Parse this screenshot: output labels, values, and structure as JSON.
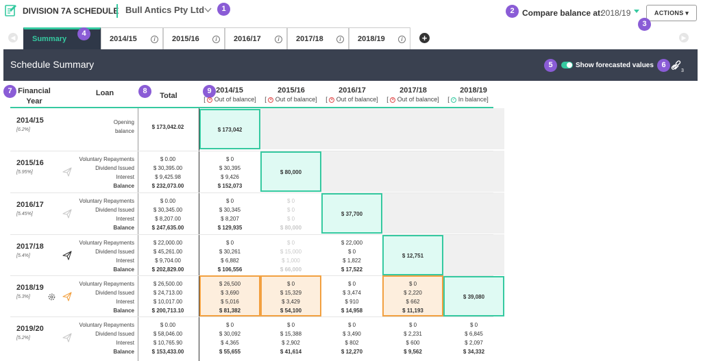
{
  "header": {
    "app_title": "DIVISION 7A SCHEDULE",
    "company": "Bull Antics Pty Ltd",
    "compare_label": "Compare balance at:",
    "compare_value": "2018/19",
    "actions_label": "ACTIONS ▾"
  },
  "badges": [
    "1",
    "2",
    "3",
    "4",
    "5",
    "6",
    "7",
    "8",
    "9"
  ],
  "tabs": [
    {
      "label": "Summary",
      "active": true
    },
    {
      "label": "2014/15"
    },
    {
      "label": "2015/16"
    },
    {
      "label": "2016/17"
    },
    {
      "label": "2017/18"
    },
    {
      "label": "2018/19"
    }
  ],
  "summary": {
    "title": "Schedule Summary",
    "toggle_label": "Show forecasted values",
    "link_count": "3"
  },
  "columns": {
    "financial_year": "Financial Year",
    "loan": "Loan",
    "total": "Total",
    "years": [
      {
        "label": "2014/15",
        "status": "Out of balance",
        "ok": false
      },
      {
        "label": "2015/16",
        "status": "Out of balance",
        "ok": false
      },
      {
        "label": "2016/17",
        "status": "Out of balance",
        "ok": false
      },
      {
        "label": "2017/18",
        "status": "Out of balance",
        "ok": false
      },
      {
        "label": "2018/19",
        "status": "In balance",
        "ok": true
      }
    ]
  },
  "row_labels": {
    "opening_1": "Opening",
    "opening_2": "balance",
    "voluntary": "Voluntary Repayments",
    "dividend": "Dividend Issued",
    "interest": "Interest",
    "balance": "Balance"
  },
  "rows": [
    {
      "fy": "2014/15",
      "rate": "[6.2%]",
      "opening_total": "$ 173,042.02",
      "diag": "$ 173,042"
    },
    {
      "fy": "2015/16",
      "rate": "[5.95%]",
      "totals": [
        "$ 0.00",
        "$ 30,395.00",
        "$ 9,425.98",
        "$ 232,073.00"
      ],
      "cols": [
        [
          "$ 0",
          "$ 30,395",
          "$ 9,426",
          "$ 152,073"
        ]
      ],
      "diag": "$ 80,000"
    },
    {
      "fy": "2016/17",
      "rate": "[5.45%]",
      "totals": [
        "$ 0.00",
        "$ 30,345.00",
        "$ 8,207.00",
        "$ 247,635.00"
      ],
      "cols": [
        [
          "$ 0",
          "$ 30,345",
          "$ 8,207",
          "$ 129,935"
        ],
        [
          "$ 0",
          "$ 0",
          "$ 0",
          "$ 80,000"
        ]
      ],
      "diag": "$ 37,700"
    },
    {
      "fy": "2017/18",
      "rate": "[5.4%]",
      "totals": [
        "$ 22,000.00",
        "$ 45,261.00",
        "$ 9,704.00",
        "$ 202,829.00"
      ],
      "cols": [
        [
          "$ 0",
          "$ 30,261",
          "$ 6,882",
          "$ 106,556"
        ],
        [
          "$ 0",
          "$ 15,000",
          "$ 1,000",
          "$ 66,000"
        ],
        [
          "$ 22,000",
          "$ 0",
          "$ 1,822",
          "$ 17,522"
        ]
      ],
      "diag": "$ 12,751"
    },
    {
      "fy": "2018/19",
      "rate": "[5.3%]",
      "totals": [
        "$ 26,500.00",
        "$ 24,713.00",
        "$ 10,017.00",
        "$ 200,713.10"
      ],
      "cols": [
        [
          "$ 26,500",
          "$ 3,690",
          "$ 5,016",
          "$ 81,382"
        ],
        [
          "$ 0",
          "$ 15,329",
          "$ 3,429",
          "$ 54,100"
        ],
        [
          "$ 0",
          "$ 3,474",
          "$ 910",
          "$ 14,958"
        ],
        [
          "$ 0",
          "$ 2,220",
          "$ 662",
          "$ 11,193"
        ]
      ],
      "diag": "$ 39,080"
    },
    {
      "fy": "2019/20",
      "rate": "[5.2%]",
      "totals": [
        "$ 0.00",
        "$ 58,046.00",
        "$ 10,765.90",
        "$ 153,433.00"
      ],
      "cols": [
        [
          "$ 0",
          "$ 30,092",
          "$ 4,365",
          "$ 55,655"
        ],
        [
          "$ 0",
          "$ 15,388",
          "$ 2,902",
          "$ 41,614"
        ],
        [
          "$ 0",
          "$ 3,490",
          "$ 802",
          "$ 12,270"
        ],
        [
          "$ 0",
          "$ 2,231",
          "$ 600",
          "$ 9,562"
        ],
        [
          "$ 0",
          "$ 6,845",
          "$ 2,097",
          "$ 34,332"
        ]
      ]
    }
  ],
  "colors": {
    "accent": "#35c9a0",
    "dark": "#3a4150",
    "warn": "#f2a040",
    "badge": "#8a5cd6"
  }
}
